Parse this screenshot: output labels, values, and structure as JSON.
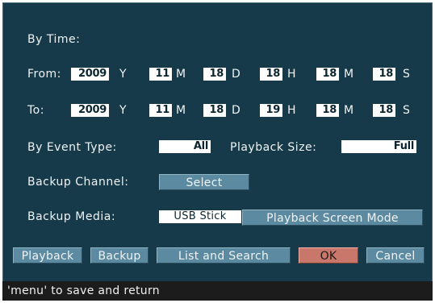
{
  "by_time_label": "By Time:",
  "from": {
    "label": "From:",
    "year": "2009",
    "year_unit": "Y",
    "month": "11",
    "month_unit": "M",
    "day": "18",
    "day_unit": "D",
    "hour": "18",
    "hour_unit": "H",
    "minute": "18",
    "minute_unit": "M",
    "second": "18",
    "second_unit": "S"
  },
  "to": {
    "label": "To:",
    "year": "2009",
    "year_unit": "Y",
    "month": "11",
    "month_unit": "M",
    "day": "18",
    "day_unit": "D",
    "hour": "19",
    "hour_unit": "H",
    "minute": "18",
    "minute_unit": "M",
    "second": "18",
    "second_unit": "S"
  },
  "event_type": {
    "label": "By Event Type:",
    "value": "All"
  },
  "playback_size": {
    "label": "Playback Size:",
    "value": "Full"
  },
  "backup_channel": {
    "label": "Backup Channel:",
    "button": "Select"
  },
  "backup_media": {
    "label": "Backup Media:",
    "value": "USB Stick",
    "mode_button": "Playback Screen Mode"
  },
  "buttons": {
    "playback": "Playback",
    "backup": "Backup",
    "list_search": "List and Search",
    "ok": "OK",
    "cancel": "Cancel"
  },
  "status": "'menu' to save and return"
}
